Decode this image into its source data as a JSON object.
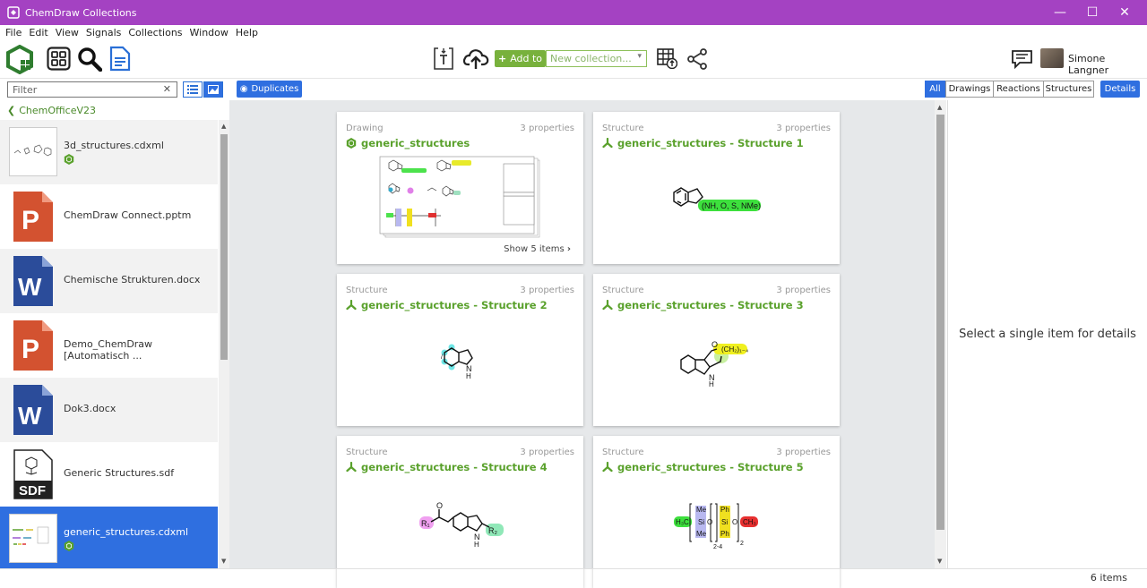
{
  "window": {
    "title": "ChemDraw Collections",
    "minimize": "—",
    "maximize": "☐",
    "close": "✕"
  },
  "menu": [
    "File",
    "Edit",
    "View",
    "Signals",
    "Collections",
    "Window",
    "Help"
  ],
  "toolbar": {
    "add_to_label": "Add to",
    "collection_placeholder": "New collection...",
    "user_name": "Simone Langner"
  },
  "filter": {
    "placeholder": "Filter"
  },
  "duplicates_label": "Duplicates",
  "breadcrumb": "ChemOfficeV23",
  "type_filters": [
    {
      "label": "All",
      "active": true
    },
    {
      "label": "Drawings",
      "active": false
    },
    {
      "label": "Reactions",
      "active": false
    },
    {
      "label": "Structures",
      "active": false
    }
  ],
  "details_button": "Details",
  "files": [
    {
      "name": "3d_structures.cdxml",
      "kind": "cdxml",
      "selected": false
    },
    {
      "name": "ChemDraw Connect.pptm",
      "kind": "pptx",
      "selected": false
    },
    {
      "name": "Chemische Strukturen.docx",
      "kind": "docx",
      "selected": false
    },
    {
      "name": "Demo_ChemDraw [Automatisch ...",
      "kind": "pptx",
      "selected": false
    },
    {
      "name": "Dok3.docx",
      "kind": "docx",
      "selected": false
    },
    {
      "name": "Generic Structures.sdf",
      "kind": "sdf",
      "selected": false
    },
    {
      "name": "generic_structures.cdxml",
      "kind": "cdxml",
      "selected": true
    }
  ],
  "cards": [
    {
      "type": "Drawing",
      "props": "3 properties",
      "name": "generic_structures",
      "show": "Show 5 items"
    },
    {
      "type": "Structure",
      "props": "3 properties",
      "name": "generic_structures - Structure 1"
    },
    {
      "type": "Structure",
      "props": "3 properties",
      "name": "generic_structures - Structure 2"
    },
    {
      "type": "Structure",
      "props": "3 properties",
      "name": "generic_structures - Structure 3"
    },
    {
      "type": "Structure",
      "props": "3 properties",
      "name": "generic_structures - Structure 4"
    },
    {
      "type": "Structure",
      "props": "3 properties",
      "name": "generic_structures - Structure 5"
    }
  ],
  "molecule_labels": {
    "s1": "(NH, O, S, NMe)",
    "s2_n": "N",
    "s2_h": "H",
    "s3_o": "O",
    "s3_chain": "(CH₂)₁₋₄",
    "s3_n": "N",
    "s3_h": "H",
    "s4_r1": "R₁",
    "s4_r2": "R₂",
    "s4_o": "O",
    "s4_n": "N",
    "s4_h": "H",
    "s5_left": "H₃C",
    "s5_right": "CH₃",
    "s5_me": "Me",
    "s5_si": "Si",
    "s5_ph": "Ph",
    "s5_o": "O",
    "s5_sub1": "2-4",
    "s5_sub2": "2"
  },
  "details_placeholder": "Select a single item for details",
  "status": {
    "count": "6 items"
  },
  "colors": {
    "titlebar": "#a442c2",
    "accent": "#2f6fe0",
    "green": "#5aa12c"
  }
}
